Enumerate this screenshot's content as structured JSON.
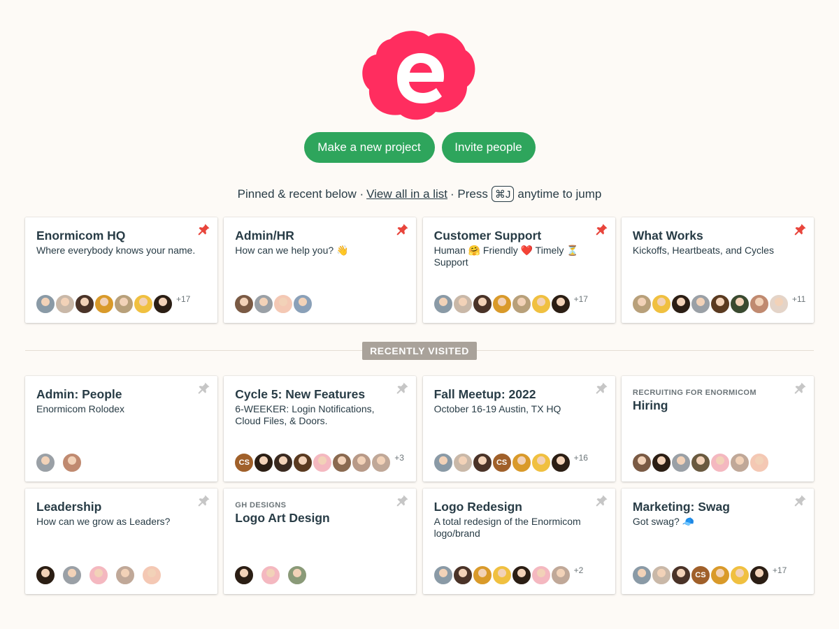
{
  "brand": {
    "logo_letter": "e",
    "logo_color": "#ff2d5f"
  },
  "actions": {
    "new_project": "Make a new project",
    "invite": "Invite people"
  },
  "pinned_line": {
    "lead": "Pinned & recent below ·",
    "link": "View all in a list",
    "press": "· Press",
    "kbd": "⌘J",
    "tail": "anytime to jump"
  },
  "section": {
    "recently_visited": "RECENTLY VISITED"
  },
  "pinned": [
    {
      "eyebrow": "",
      "title": "Enormicom HQ",
      "desc": "Where everybody knows your name.",
      "more": "+17",
      "pinned": true,
      "avatars": [
        "#8a9aa6",
        "#c9b8a8",
        "#4a3328",
        "#d99a2a",
        "#b8a07a",
        "#f0c040",
        "#2b1e14"
      ]
    },
    {
      "eyebrow": "",
      "title": "Admin/HR",
      "desc": "How can we help you? 👋",
      "more": "",
      "pinned": true,
      "avatars": [
        "#7a5a44",
        "#9aa0a6",
        "#f4c8b4",
        "#8aa0b8"
      ]
    },
    {
      "eyebrow": "",
      "title": "Customer Support",
      "desc": "Human 🤗 Friendly ❤️ Timely ⏳ Support",
      "more": "+17",
      "pinned": true,
      "avatars": [
        "#8a9aa6",
        "#c9b8a8",
        "#4a3328",
        "#d99a2a",
        "#b8a07a",
        "#f0c040",
        "#2b1e14"
      ]
    },
    {
      "eyebrow": "",
      "title": "What Works",
      "desc": "Kickoffs, Heartbeats, and Cycles",
      "more": "+11",
      "pinned": true,
      "avatars": [
        "#b8a07a",
        "#f0c040",
        "#2b1e14",
        "#9aa0a6",
        "#5a3a20",
        "#3a4a30",
        "#c08a70",
        "#e4d4c8"
      ]
    }
  ],
  "recent": [
    {
      "eyebrow": "",
      "title": "Admin: People",
      "desc": "Enormicom Rolodex",
      "more": "",
      "pinned": false,
      "spaced": true,
      "avatars": [
        "#9aa0a6",
        "#c08a70"
      ]
    },
    {
      "eyebrow": "",
      "title": "Cycle 5: New Features",
      "desc": "6-WEEKER: Login Notifications, Cloud Files, & Doors.",
      "more": "+3",
      "pinned": false,
      "avatars": [
        {
          "initials": "CS",
          "c": "#a0602a"
        },
        "#2b1e14",
        "#3a2a20",
        "#5a3a20",
        "#f4b8c0",
        "#8a6a50",
        "#b89a88",
        "#c0a898"
      ]
    },
    {
      "eyebrow": "",
      "title": "Fall Meetup: 2022",
      "desc": "October 16-19 Austin, TX HQ",
      "more": "+16",
      "pinned": false,
      "avatars": [
        "#8a9aa6",
        "#c9b8a8",
        "#4a3328",
        {
          "initials": "CS",
          "c": "#a0602a"
        },
        "#d99a2a",
        "#f0c040",
        "#2b1e14"
      ]
    },
    {
      "eyebrow": "RECRUITING FOR ENORMICOM",
      "title": "Hiring",
      "desc": "",
      "more": "",
      "pinned": false,
      "avatars": [
        "#7a5a44",
        "#2b1e14",
        "#9aa0a6",
        "#6a5a40",
        "#f4b8c0",
        "#c0a898",
        "#f4c8b4"
      ]
    },
    {
      "eyebrow": "",
      "title": "Leadership",
      "desc": "How can we grow as Leaders?",
      "more": "",
      "pinned": false,
      "spaced": true,
      "avatars": [
        "#2b1e14",
        "#9aa0a6",
        "#f4b8c0",
        "#c0a898",
        "#f4c8b4"
      ]
    },
    {
      "eyebrow": "GH DESIGNS",
      "title": "Logo Art Design",
      "desc": "",
      "more": "",
      "pinned": false,
      "spaced": true,
      "avatars": [
        "#2b1e14",
        "#f4b8c0",
        "#8a9a78"
      ]
    },
    {
      "eyebrow": "",
      "title": "Logo Redesign",
      "desc": "A total redesign of the Enormicom logo/brand",
      "more": "+2",
      "pinned": false,
      "avatars": [
        "#8a9aa6",
        "#4a3328",
        "#d99a2a",
        "#f0c040",
        "#2b1e14",
        "#f4b8c0",
        "#c0a898"
      ]
    },
    {
      "eyebrow": "",
      "title": "Marketing: Swag",
      "desc": "Got swag? 🧢",
      "more": "+17",
      "pinned": false,
      "avatars": [
        "#8a9aa6",
        "#c9b8a8",
        "#4a3328",
        {
          "initials": "CS",
          "c": "#a0602a"
        },
        "#d99a2a",
        "#f0c040",
        "#2b1e14"
      ]
    }
  ]
}
